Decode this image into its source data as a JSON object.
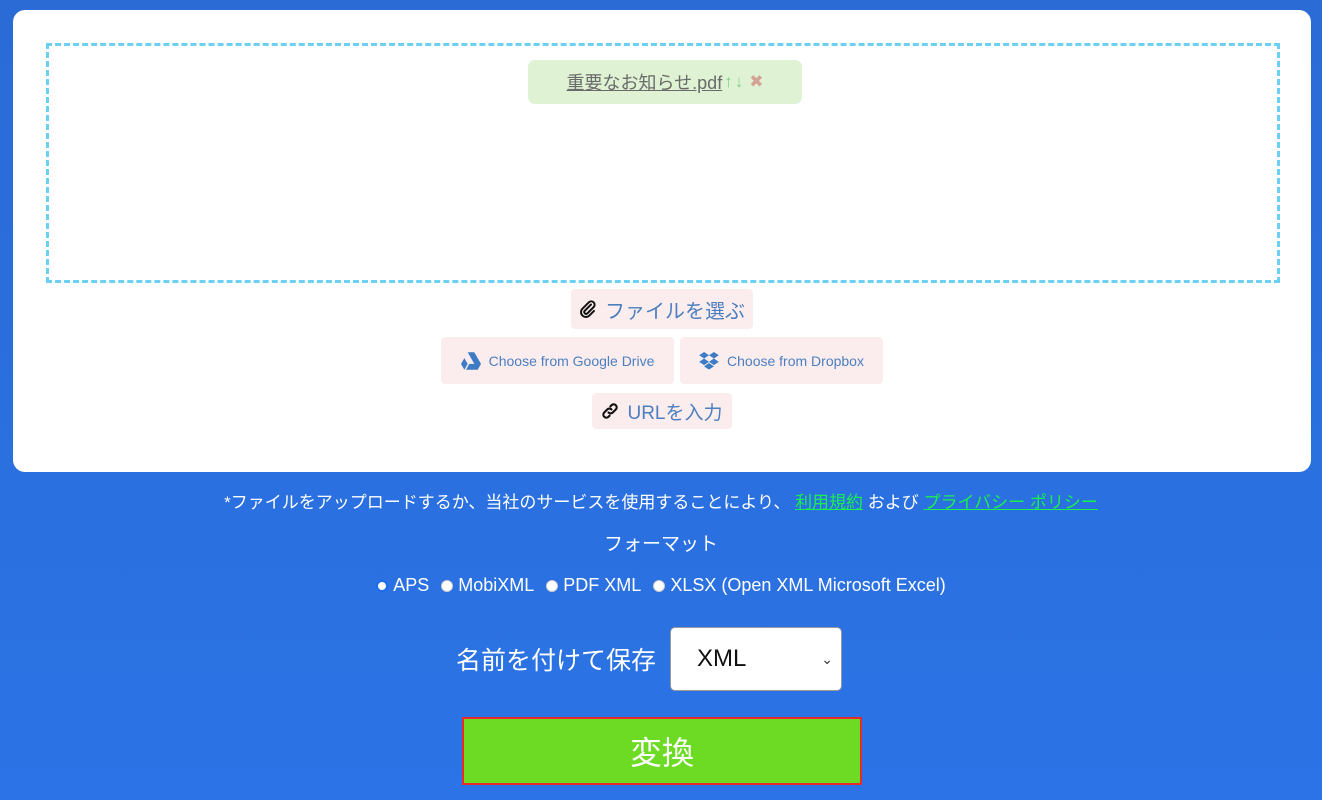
{
  "upload": {
    "file": {
      "name": "重要なお知らせ.pdf",
      "move_up_icon": "↑",
      "move_down_icon": "↓",
      "remove_icon": "✖"
    },
    "choose_file_label": "ファイルを選ぶ",
    "google_drive_label": "Choose from Google Drive",
    "dropbox_label": "Choose from Dropbox",
    "url_label": "URLを入力"
  },
  "terms": {
    "prefix": "*ファイルをアップロードするか、当社のサービスを使用することにより、 ",
    "terms_link": "利用規約",
    "middle": " および ",
    "privacy_link": "プライバシー ポリシー"
  },
  "format": {
    "title": "フォーマット",
    "options": [
      {
        "label": "APS",
        "checked": true
      },
      {
        "label": "MobiXML",
        "checked": false
      },
      {
        "label": "PDF XML",
        "checked": false
      },
      {
        "label": "XLSX (Open XML Microsoft Excel)",
        "checked": false
      }
    ]
  },
  "save_as": {
    "label": "名前を付けて保存",
    "selected": "XML"
  },
  "convert_label": "変換",
  "colors": {
    "background": "#2b73e6",
    "convert_button": "#6ddb23",
    "link": "#19f04e",
    "dropzone_border": "#6cd0f2"
  }
}
